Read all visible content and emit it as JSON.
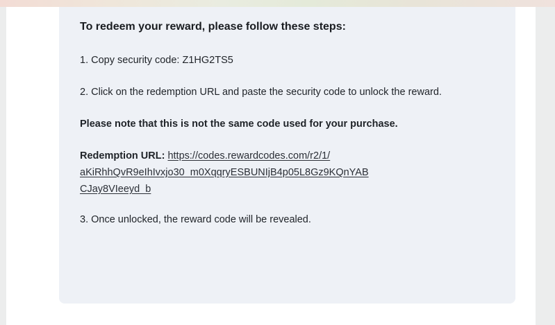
{
  "reward_instructions": {
    "heading": "To redeem your reward, please follow these steps:",
    "step1": "1. Copy security code: Z1HG2TS5",
    "step2": "2. Click on the redemption URL and paste the security code to unlock the reward.",
    "note": "Please note that this is not the same code used for your purchase.",
    "redemption_label": "Redemption URL:",
    "redemption_url_line1": "https://codes.rewardcodes.com/r2/1/",
    "redemption_url_line2": "aKiRhhQvR9eIhIvxjo30_m0XqqryESBUNIjB4p05L8Gz9KQnYAB",
    "redemption_url_line3": "CJay8VIeeyd_b",
    "step3": "3. Once unlocked, the reward code will be revealed."
  },
  "colors": {
    "card_background": "#eef1f6",
    "page_background": "#ffffff",
    "text": "#1f2328"
  }
}
